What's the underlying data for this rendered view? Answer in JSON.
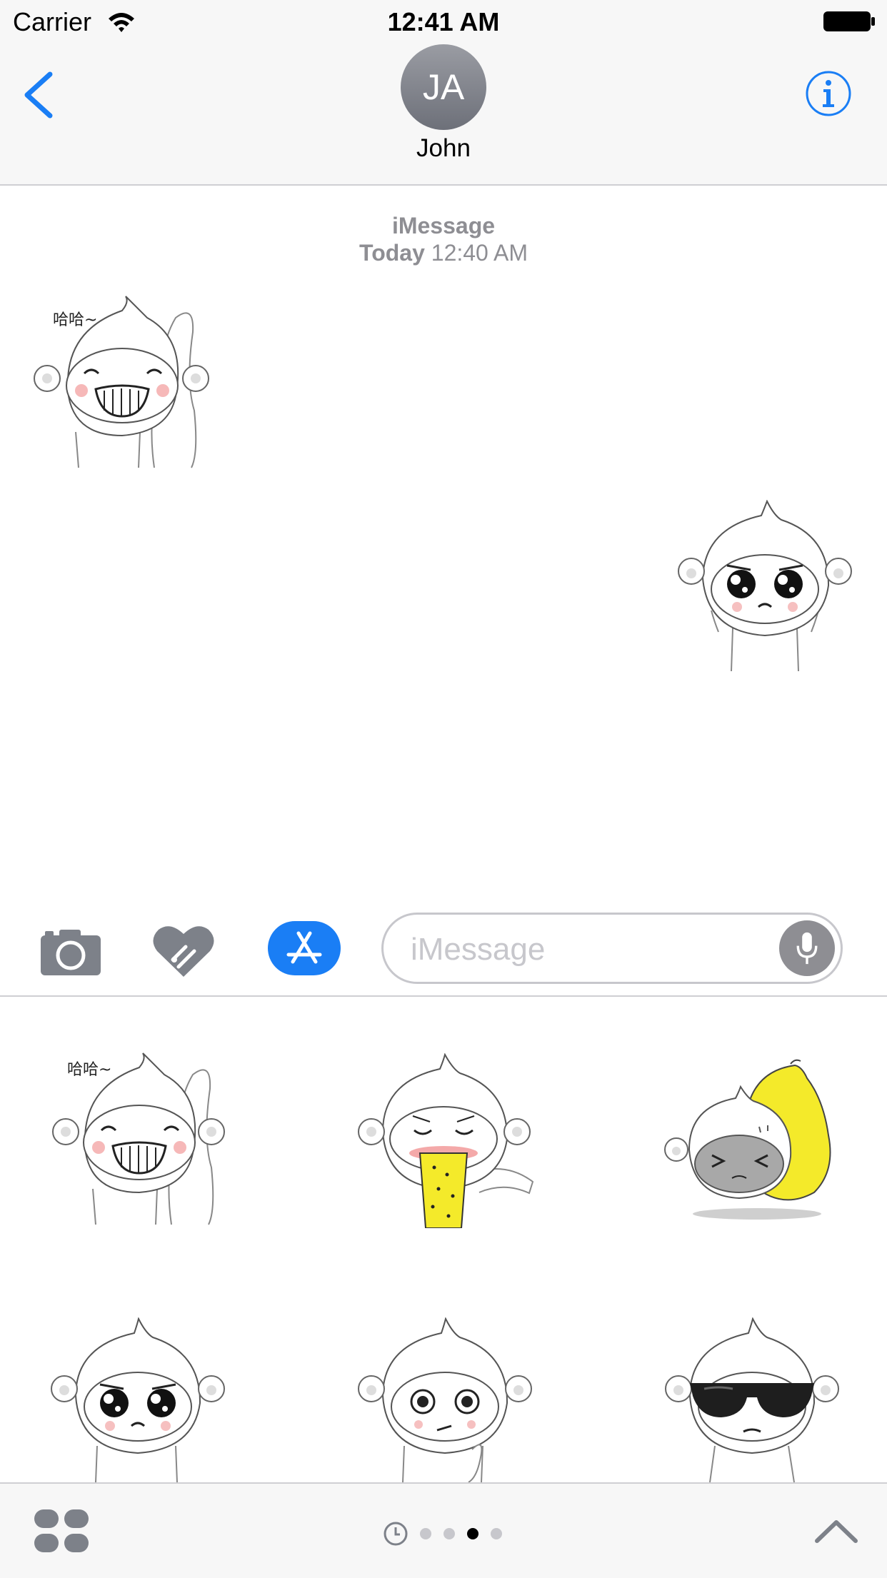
{
  "status": {
    "carrier": "Carrier",
    "time": "12:41 AM"
  },
  "header": {
    "avatar_initials": "JA",
    "contact_name": "John"
  },
  "conversation": {
    "service": "iMessage",
    "day": "Today",
    "time": "12:40 AM",
    "sticker_text": "哈哈~"
  },
  "input": {
    "placeholder": "iMessage"
  },
  "drawer": {
    "sticker_text": "哈哈~",
    "page_count": 4,
    "current_page": 3
  },
  "colors": {
    "accent": "#1a7ef5",
    "gray": "#8e8e93",
    "yellow": "#f4ea2a"
  },
  "icons": [
    "wifi-icon",
    "battery-icon",
    "back-chevron-icon",
    "info-icon",
    "camera-icon",
    "digital-touch-icon",
    "app-store-icon",
    "microphone-icon",
    "app-grid-icon",
    "recents-clock-icon",
    "chevron-up-icon"
  ]
}
